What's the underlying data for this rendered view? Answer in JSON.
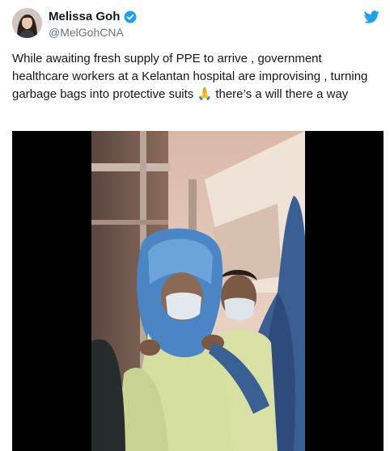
{
  "author": {
    "display_name": "Melissa Goh",
    "handle": "@MelGohCNA",
    "verified": true
  },
  "tweet": {
    "text": "While awaiting fresh supply of PPE to arrive , government healthcare workers at a Kelantan hospital are improvising , turning garbage bags into protective suits 🙏 there’s a will there a way"
  },
  "icons": {
    "platform": "twitter-bird-icon",
    "verified": "verified-badge-icon"
  },
  "colors": {
    "brand_blue": "#1da1f2",
    "text": "#14171a",
    "secondary_text": "#657786",
    "media_background": "#000000"
  }
}
